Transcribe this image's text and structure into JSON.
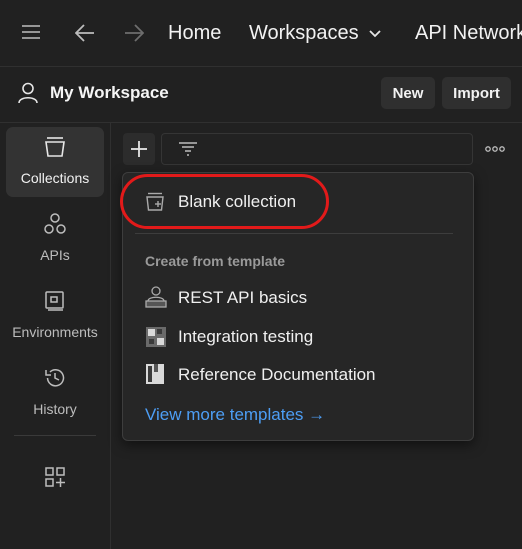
{
  "topnav": {
    "home": "Home",
    "workspaces": "Workspaces",
    "api_network": "API Network"
  },
  "workspace": {
    "title": "My Workspace",
    "new_label": "New",
    "import_label": "Import"
  },
  "sidebar": {
    "items": [
      {
        "label": "Collections",
        "icon": "collections-icon",
        "active": true
      },
      {
        "label": "APIs",
        "icon": "apis-icon",
        "active": false
      },
      {
        "label": "Environments",
        "icon": "environments-icon",
        "active": false
      },
      {
        "label": "History",
        "icon": "history-icon",
        "active": false
      }
    ]
  },
  "menu": {
    "blank_collection": "Blank collection",
    "template_heading": "Create from template",
    "templates": [
      {
        "label": "REST API basics",
        "icon": "rest-api-icon"
      },
      {
        "label": "Integration testing",
        "icon": "integration-testing-icon"
      },
      {
        "label": "Reference Documentation",
        "icon": "reference-docs-icon"
      }
    ],
    "view_more": "View more templates →"
  },
  "colors": {
    "background": "#212121",
    "highlight": "#e21a1a",
    "link": "#4d9ef5"
  }
}
